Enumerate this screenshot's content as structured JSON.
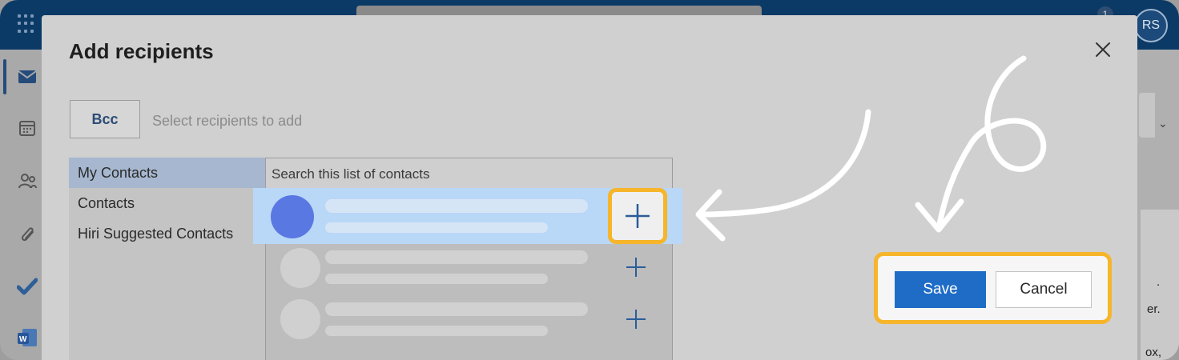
{
  "app": {
    "user_initials": "RS",
    "notification_count": "1",
    "right_panel_snippets": [
      ".",
      "er.",
      "ox,"
    ]
  },
  "dialog": {
    "title": "Add recipients",
    "bcc_label": "Bcc",
    "recipients_placeholder": "Select recipients to add",
    "contact_lists": [
      {
        "label": "My Contacts",
        "selected": true
      },
      {
        "label": "Contacts",
        "selected": false
      },
      {
        "label": "Hiri Suggested Contacts",
        "selected": false
      }
    ],
    "search_placeholder": "Search this list of contacts",
    "save_label": "Save",
    "cancel_label": "Cancel"
  },
  "icons": {
    "close": "close-icon",
    "add_contact": "plus-icon",
    "annotation_arrows": "arrow-annotation",
    "rail": [
      "mail-icon",
      "calendar-icon",
      "people-icon",
      "attachment-icon",
      "todo-check-icon",
      "word-icon"
    ]
  },
  "colors": {
    "highlight_border": "#f6b52a",
    "save_button": "#1f6cc7",
    "selected_row": "#b9d7f7",
    "contact_avatar": "#5a78e2"
  }
}
